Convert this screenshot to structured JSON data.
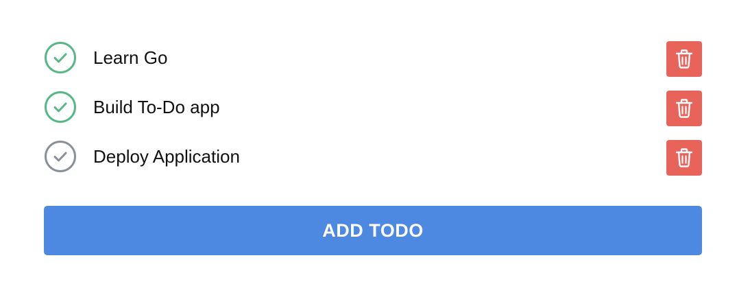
{
  "colors": {
    "done": "#58b786",
    "pending": "#8a8f98",
    "delete": "#e8635a",
    "primary": "#4d89e1"
  },
  "todos": [
    {
      "text": "Learn Go",
      "done": true,
      "check_icon": "check-circle-icon",
      "delete_icon": "trash-icon"
    },
    {
      "text": "Build To-Do app",
      "done": true,
      "check_icon": "check-circle-icon",
      "delete_icon": "trash-icon"
    },
    {
      "text": "Deploy Application",
      "done": false,
      "check_icon": "check-circle-icon",
      "delete_icon": "trash-icon"
    }
  ],
  "add_button": {
    "label": "ADD TODO"
  }
}
